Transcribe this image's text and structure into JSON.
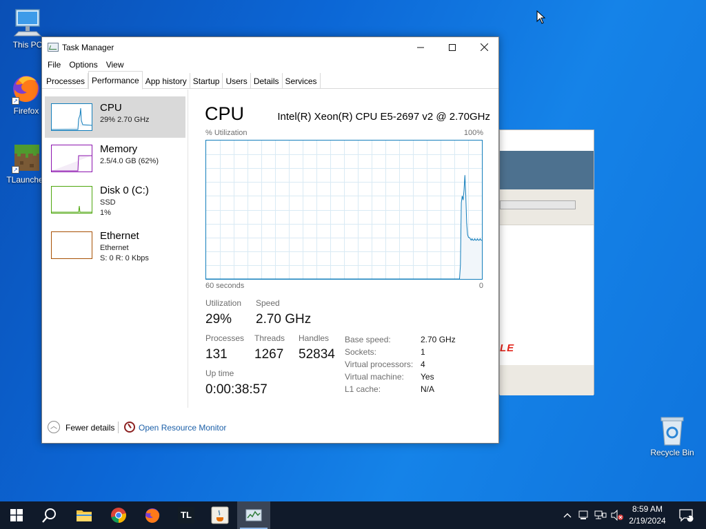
{
  "desktop": {
    "icons": [
      {
        "label": "This PC"
      },
      {
        "label": "Firefox"
      },
      {
        "label": "TLauncher"
      },
      {
        "label": "Recycle Bin"
      }
    ]
  },
  "background_window": {
    "logo_text": "LE"
  },
  "task_manager": {
    "title": "Task Manager",
    "controls": {
      "minimize": "—",
      "maximize": "☐",
      "close": "✕"
    },
    "menu": [
      "File",
      "Options",
      "View"
    ],
    "tabs": [
      "Processes",
      "Performance",
      "App history",
      "Startup",
      "Users",
      "Details",
      "Services"
    ],
    "active_tab": "Performance",
    "resources": [
      {
        "name": "CPU",
        "line1": "29%  2.70 GHz",
        "color": "#117dbb"
      },
      {
        "name": "Memory",
        "line1": "2.5/4.0 GB (62%)",
        "color": "#8b12ae"
      },
      {
        "name": "Disk 0 (C:)",
        "line1": "SSD",
        "line2": "1%",
        "color": "#4da60c"
      },
      {
        "name": "Ethernet",
        "line1": "Ethernet",
        "line2": "S: 0  R: 0 Kbps",
        "color": "#a74f01"
      }
    ],
    "detail": {
      "title": "CPU",
      "model": "Intel(R) Xeon(R) CPU E5-2697 v2 @ 2.70GHz",
      "graph_label": "% Utilization",
      "graph_max": "100%",
      "graph_time": "60 seconds",
      "graph_min": "0",
      "stats": {
        "utilization_label": "Utilization",
        "utilization": "29%",
        "speed_label": "Speed",
        "speed": "2.70 GHz",
        "processes_label": "Processes",
        "processes": "131",
        "threads_label": "Threads",
        "threads": "1267",
        "handles_label": "Handles",
        "handles": "52834",
        "uptime_label": "Up time",
        "uptime": "0:00:38:57"
      },
      "info": [
        {
          "k": "Base speed:",
          "v": "2.70 GHz"
        },
        {
          "k": "Sockets:",
          "v": "1"
        },
        {
          "k": "Virtual processors:",
          "v": "4"
        },
        {
          "k": "Virtual machine:",
          "v": "Yes"
        },
        {
          "k": "L1 cache:",
          "v": "N/A"
        }
      ]
    },
    "footer": {
      "fewer_details": "Fewer details",
      "open_resource_monitor": "Open Resource Monitor"
    },
    "cpu_history_percent": [
      0,
      0,
      0,
      0,
      0,
      0,
      0,
      0,
      0,
      0,
      0,
      0,
      0,
      0,
      0,
      0,
      0,
      0,
      0,
      0,
      0,
      0,
      0,
      0,
      0,
      0,
      0,
      0,
      0,
      0,
      0,
      0,
      0,
      0,
      0,
      0,
      0,
      0,
      0,
      0,
      0,
      0,
      0,
      0,
      0,
      0,
      0,
      0,
      0,
      0,
      0,
      0,
      0,
      0,
      0,
      0,
      0,
      0,
      0,
      0,
      0,
      0,
      0,
      0,
      0,
      0,
      0,
      0,
      0,
      0,
      0,
      0,
      0,
      0,
      0,
      0,
      0,
      0,
      0,
      0,
      0,
      0,
      0,
      0,
      0,
      0,
      0,
      0,
      0,
      0,
      0,
      0,
      0,
      0,
      0,
      0,
      0,
      0,
      0,
      0,
      0,
      0,
      0,
      0,
      0,
      0,
      0,
      0,
      0,
      0,
      0,
      0,
      0,
      0,
      0,
      0,
      0,
      0,
      0,
      0,
      0,
      0,
      0,
      0,
      0,
      0,
      0,
      0,
      0,
      0,
      0,
      0,
      0,
      0,
      0,
      0,
      0,
      0,
      0,
      0,
      0,
      0,
      0,
      0,
      0,
      0,
      0,
      0,
      0,
      0,
      0,
      0,
      0,
      0,
      0,
      0,
      0,
      0,
      0,
      0,
      0,
      0,
      0,
      0,
      0,
      0,
      0,
      0,
      0,
      0,
      0,
      0,
      0,
      0,
      0,
      0,
      0,
      0,
      0,
      0,
      0,
      0,
      0,
      0,
      0,
      0,
      0,
      0,
      0,
      0,
      0,
      0,
      0,
      0,
      0,
      0,
      0,
      0,
      0,
      0,
      0,
      0,
      0,
      0,
      0,
      0,
      0,
      0,
      0,
      0,
      0,
      0,
      0,
      0,
      0,
      0,
      0,
      0,
      0,
      0,
      0,
      0,
      0,
      0,
      0,
      0,
      0,
      0,
      0,
      0,
      0,
      0,
      0,
      0,
      0,
      0,
      0,
      0,
      0,
      0,
      0,
      0,
      0,
      0,
      0,
      0,
      0,
      0,
      0,
      0,
      0,
      0,
      0,
      0,
      0,
      0,
      0,
      0,
      0,
      0,
      0,
      0,
      0,
      0,
      0,
      0,
      0,
      0,
      0,
      0,
      0,
      0,
      0,
      0,
      0,
      0,
      0,
      0,
      0,
      0,
      0,
      0,
      0,
      0,
      10,
      55,
      60,
      57,
      64,
      75,
      60,
      40,
      32,
      30,
      30,
      29,
      28,
      29,
      28,
      28,
      29,
      28,
      28,
      29,
      28,
      28,
      29,
      28,
      28
    ]
  },
  "taskbar": {
    "apps": [
      {
        "icon": "windows-start-icon"
      },
      {
        "icon": "search-icon"
      },
      {
        "icon": "file-explorer-icon"
      },
      {
        "icon": "chrome-icon"
      },
      {
        "icon": "firefox-icon"
      },
      {
        "icon": "tlauncher-icon",
        "text": "TL"
      },
      {
        "icon": "java-icon"
      },
      {
        "icon": "task-manager-icon"
      }
    ],
    "time": "8:59 AM",
    "date": "2/19/2024",
    "notification_count": "1"
  }
}
